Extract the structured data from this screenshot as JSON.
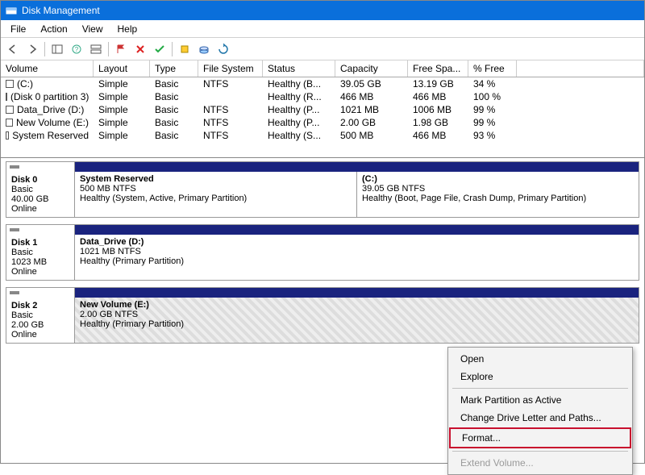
{
  "window": {
    "title": "Disk Management"
  },
  "menu": {
    "file": "File",
    "action": "Action",
    "view": "View",
    "help": "Help"
  },
  "columns": [
    "Volume",
    "Layout",
    "Type",
    "File System",
    "Status",
    "Capacity",
    "Free Spa...",
    "% Free"
  ],
  "rows": [
    {
      "vol": "(C:)",
      "layout": "Simple",
      "type": "Basic",
      "fs": "NTFS",
      "status": "Healthy (B...",
      "cap": "39.05 GB",
      "free": "13.19 GB",
      "pct": "34 %"
    },
    {
      "vol": "(Disk 0 partition 3)",
      "layout": "Simple",
      "type": "Basic",
      "fs": "",
      "status": "Healthy (R...",
      "cap": "466 MB",
      "free": "466 MB",
      "pct": "100 %"
    },
    {
      "vol": "Data_Drive (D:)",
      "layout": "Simple",
      "type": "Basic",
      "fs": "NTFS",
      "status": "Healthy (P...",
      "cap": "1021 MB",
      "free": "1006 MB",
      "pct": "99 %"
    },
    {
      "vol": "New Volume (E:)",
      "layout": "Simple",
      "type": "Basic",
      "fs": "NTFS",
      "status": "Healthy (P...",
      "cap": "2.00 GB",
      "free": "1.98 GB",
      "pct": "99 %"
    },
    {
      "vol": "System Reserved",
      "layout": "Simple",
      "type": "Basic",
      "fs": "NTFS",
      "status": "Healthy (S...",
      "cap": "500 MB",
      "free": "466 MB",
      "pct": "93 %"
    }
  ],
  "disks": [
    {
      "name": "Disk 0",
      "type": "Basic",
      "size": "40.00 GB",
      "state": "Online",
      "parts": [
        {
          "title": "System Reserved",
          "sub": "500 MB NTFS",
          "desc": "Healthy (System, Active, Primary Partition)"
        },
        {
          "title": "(C:)",
          "sub": "39.05 GB NTFS",
          "desc": "Healthy (Boot, Page File, Crash Dump, Primary Partition)"
        }
      ]
    },
    {
      "name": "Disk 1",
      "type": "Basic",
      "size": "1023 MB",
      "state": "Online",
      "parts": [
        {
          "title": "Data_Drive  (D:)",
          "sub": "1021 MB NTFS",
          "desc": "Healthy (Primary Partition)"
        }
      ]
    },
    {
      "name": "Disk 2",
      "type": "Basic",
      "size": "2.00 GB",
      "state": "Online",
      "hatched": true,
      "parts": [
        {
          "title": "New Volume  (E:)",
          "sub": "2.00 GB NTFS",
          "desc": "Healthy (Primary Partition)"
        }
      ]
    }
  ],
  "ctx": {
    "open": "Open",
    "explore": "Explore",
    "mark": "Mark Partition as Active",
    "change": "Change Drive Letter and Paths...",
    "format": "Format...",
    "extend": "Extend Volume..."
  }
}
